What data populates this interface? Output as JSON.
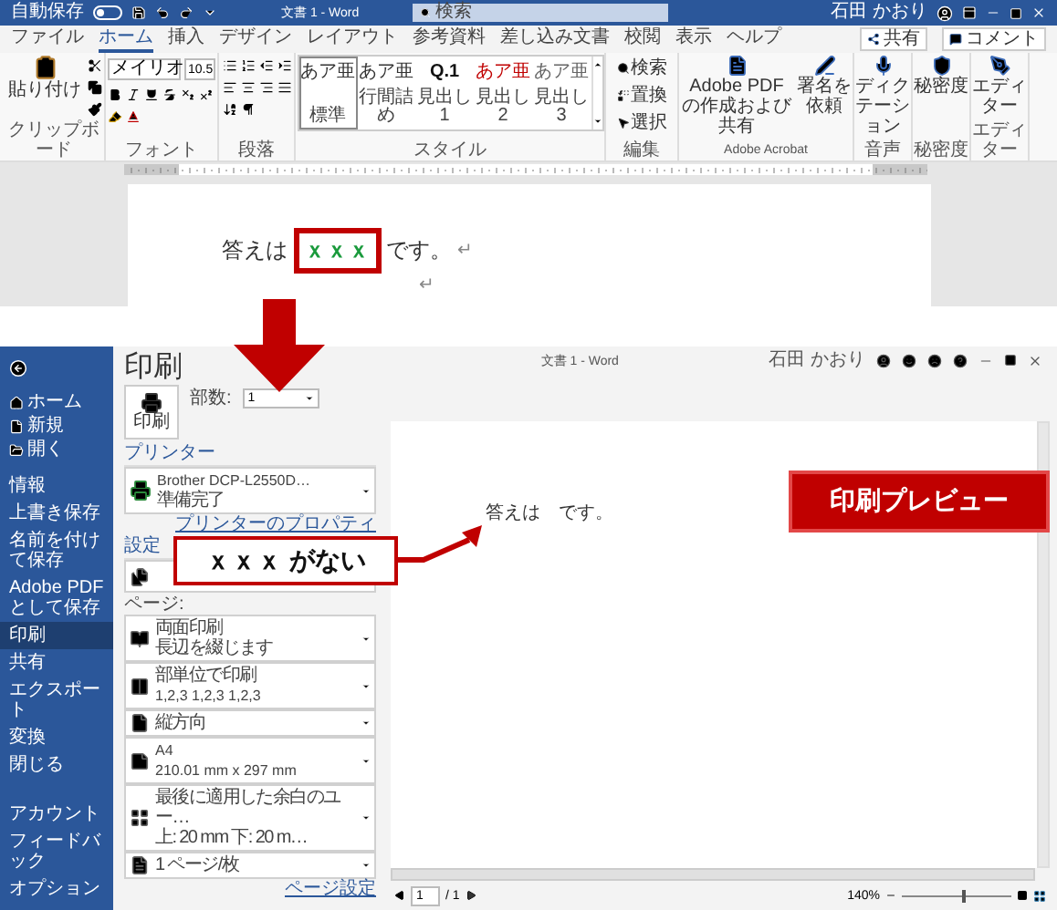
{
  "word_window": {
    "title_bar": {
      "autosave_label": "自動保存",
      "autosave_on": false,
      "title": "文書 1 - Word",
      "search_placeholder": "検索",
      "user": "石田 かおり"
    },
    "tabs": [
      {
        "label": "ファイル",
        "selected": false
      },
      {
        "label": "ホーム",
        "selected": true
      },
      {
        "label": "挿入",
        "selected": false
      },
      {
        "label": "デザイン",
        "selected": false
      },
      {
        "label": "レイアウト",
        "selected": false
      },
      {
        "label": "参考資料",
        "selected": false
      },
      {
        "label": "差し込み文書",
        "selected": false
      },
      {
        "label": "校閲",
        "selected": false
      },
      {
        "label": "表示",
        "selected": false
      },
      {
        "label": "ヘルプ",
        "selected": false
      }
    ],
    "share": "共有",
    "comment": "コメント",
    "groups": [
      {
        "kind": "clipboard",
        "label": "クリップボード",
        "paste": "貼り付け"
      },
      {
        "kind": "font",
        "label": "フォント",
        "font": "メイリオ",
        "size": "10.5"
      },
      {
        "kind": "paragraph",
        "label": "段落"
      },
      {
        "kind": "styles",
        "label": "スタイル",
        "styles": [
          {
            "preview": "あア亜",
            "name": "標準",
            "selected": true,
            "color": "#333333"
          },
          {
            "preview": "あア亜",
            "name": "行間詰め",
            "selected": false,
            "color": "#333333"
          },
          {
            "preview": "Q.1",
            "name": "見出し 1",
            "selected": false,
            "color": "#111111"
          },
          {
            "preview": "あア亜",
            "name": "見出し 2",
            "selected": false,
            "color": "#c00000"
          },
          {
            "preview": "あア亜",
            "name": "見出し 3",
            "selected": false,
            "color": "#666666"
          }
        ]
      },
      {
        "kind": "editing",
        "label": "編集",
        "commands": [
          "検索",
          "置換",
          "選択"
        ]
      },
      {
        "kind": "buttons",
        "label": "Adobe Acrobat",
        "buttons": [
          "Adobe PDF の作成および共有",
          "署名を依頼"
        ]
      },
      {
        "kind": "buttons",
        "label": "音声",
        "buttons": [
          "ディクテーション"
        ]
      },
      {
        "kind": "buttons",
        "label": "秘密度",
        "buttons": [
          "秘密度"
        ]
      },
      {
        "kind": "buttons",
        "label": "エディター",
        "buttons": [
          "エディター"
        ]
      }
    ],
    "document": {
      "before": "答えは",
      "highlight": "ｘｘｘ",
      "after": "です。",
      "paragraph_marks": [
        "↵",
        "↵"
      ]
    }
  },
  "print_view": {
    "sidebar": {
      "top": [
        {
          "kind": "home",
          "label": "ホーム"
        },
        {
          "kind": "new",
          "label": "新規"
        },
        {
          "kind": "open",
          "label": "開く"
        }
      ],
      "items": [
        {
          "label": "情報",
          "selected": false
        },
        {
          "label": "上書き保存",
          "selected": false
        },
        {
          "label": "名前を付けて保存",
          "selected": false
        },
        {
          "label": "Adobe PDF として保存",
          "selected": false
        },
        {
          "label": "印刷",
          "selected": true
        },
        {
          "label": "共有",
          "selected": false
        },
        {
          "label": "エクスポート",
          "selected": false
        },
        {
          "label": "変換",
          "selected": false
        },
        {
          "label": "閉じる",
          "selected": false
        }
      ],
      "bottom": [
        "アカウント",
        "フィードバック",
        "オプション"
      ]
    },
    "heading": "印刷",
    "print_button": "印刷",
    "copies_label": "部数:",
    "copies": "1",
    "printer_heading": "プリンター",
    "printer": {
      "name": "Brother DCP-L2550D…",
      "status": "準備完了"
    },
    "printer_properties": "プリンターのプロパティ",
    "settings_heading": "設定",
    "pages_label": "ページ:",
    "settings": [
      {
        "kind": "pages"
      },
      {
        "kind": "duplex",
        "lines": [
          "両面印刷",
          "長辺を綴じます"
        ]
      },
      {
        "kind": "collate",
        "lines": [
          "部単位で印刷",
          "1,2,3    1,2,3    1,2,3"
        ]
      },
      {
        "kind": "orientation",
        "lines": [
          "縦方向"
        ]
      },
      {
        "kind": "paper",
        "lines": [
          "A4",
          "210.01 mm x 297 mm"
        ]
      },
      {
        "kind": "margins",
        "lines": [
          "最後に適用した余白のユー…",
          "上: 20 mm 下: 20 m…"
        ]
      },
      {
        "kind": "per_sheet",
        "lines": [
          "1 ページ/枚"
        ]
      }
    ],
    "page_setup": "ページ設定",
    "window_title": "文書 1 - Word",
    "user": "石田 かおり",
    "preview_text": "答えは　です。",
    "page_current": "1",
    "page_total": "/ 1",
    "zoom": "140%",
    "zoom_slider": {
      "level": 0.55
    }
  },
  "callouts": {
    "missing": "ｘｘｘ がない",
    "preview_label": "印刷プレビュー"
  }
}
